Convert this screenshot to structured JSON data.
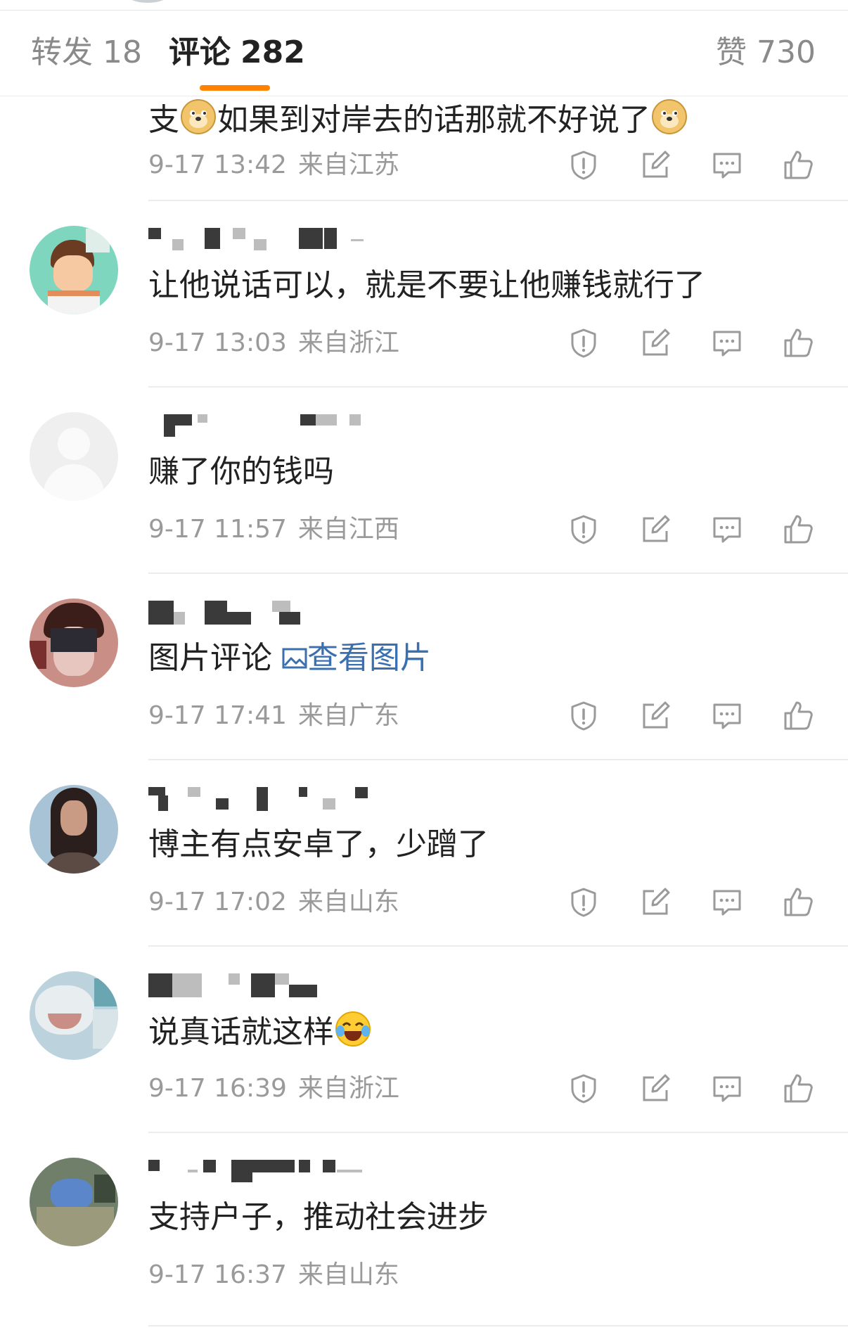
{
  "tabs": {
    "repost": {
      "label": "转发",
      "count": "18"
    },
    "comments": {
      "label": "评论",
      "count": "282"
    },
    "likes": {
      "label": "赞",
      "count": "730"
    }
  },
  "comments": [
    {
      "text_a": "支",
      "text_b": "如果到对岸去的话那就不好说了",
      "time": "9-17 13:42",
      "location": "来自江苏",
      "emoji": "doge"
    },
    {
      "text": "让他说话可以，就是不要让他赚钱就行了",
      "time": "9-17 13:03",
      "location": "来自浙江"
    },
    {
      "text": "赚了你的钱吗",
      "time": "9-17 11:57",
      "location": "来自江西"
    },
    {
      "text": "图片评论",
      "link": "查看图片",
      "time": "9-17 17:41",
      "location": "来自广东"
    },
    {
      "text": "博主有点安卓了，少蹭了",
      "time": "9-17 17:02",
      "location": "来自山东"
    },
    {
      "text": "说真话就这样",
      "time": "9-17 16:39",
      "location": "来自浙江",
      "emoji": "laughing-tears"
    },
    {
      "text": "支持户子，推动社会进步",
      "time": "9-17 16:37",
      "location": "来自山东"
    }
  ],
  "icons": {
    "report": "exclamation-shield-icon",
    "repost": "pencil-square-icon",
    "reply": "comment-bubble-icon",
    "like": "thumbs-up-icon"
  },
  "colors": {
    "accent": "#ff8200",
    "link": "#3a6fb0",
    "meta": "#9a9a9a"
  }
}
